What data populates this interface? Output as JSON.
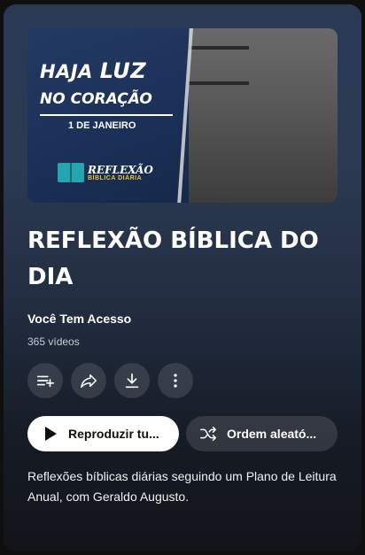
{
  "thumbnail": {
    "headline_part1": "HAJA",
    "headline_highlight": "LUZ",
    "headline_part2": "NO CORAÇÃO",
    "date": "1 DE JANEIRO",
    "brand_title": "REFLEXÃO",
    "brand_subtitle": "BÍBLICA DIÁRIA"
  },
  "playlist": {
    "title": "REFLEXÃO BÍBLICA DO DIA",
    "owner": "Você Tem Acesso",
    "video_count": "365 vídeos",
    "description": "Reflexões bíblicas diárias seguindo um Plano de Leitura Anual, com Geraldo Augusto."
  },
  "actions": {
    "icons": [
      "playlist-add-icon",
      "share-icon",
      "download-icon",
      "more-vert-icon"
    ],
    "play_label": "Reproduzir tu...",
    "shuffle_label": "Ordem aleató..."
  },
  "colors": {
    "card_top": "#2a3a55",
    "card_bottom": "#121418",
    "play_button_bg": "#ffffff",
    "secondary_button_bg": "rgba(255,255,255,0.12)",
    "brand_accent": "#24a6b0"
  }
}
